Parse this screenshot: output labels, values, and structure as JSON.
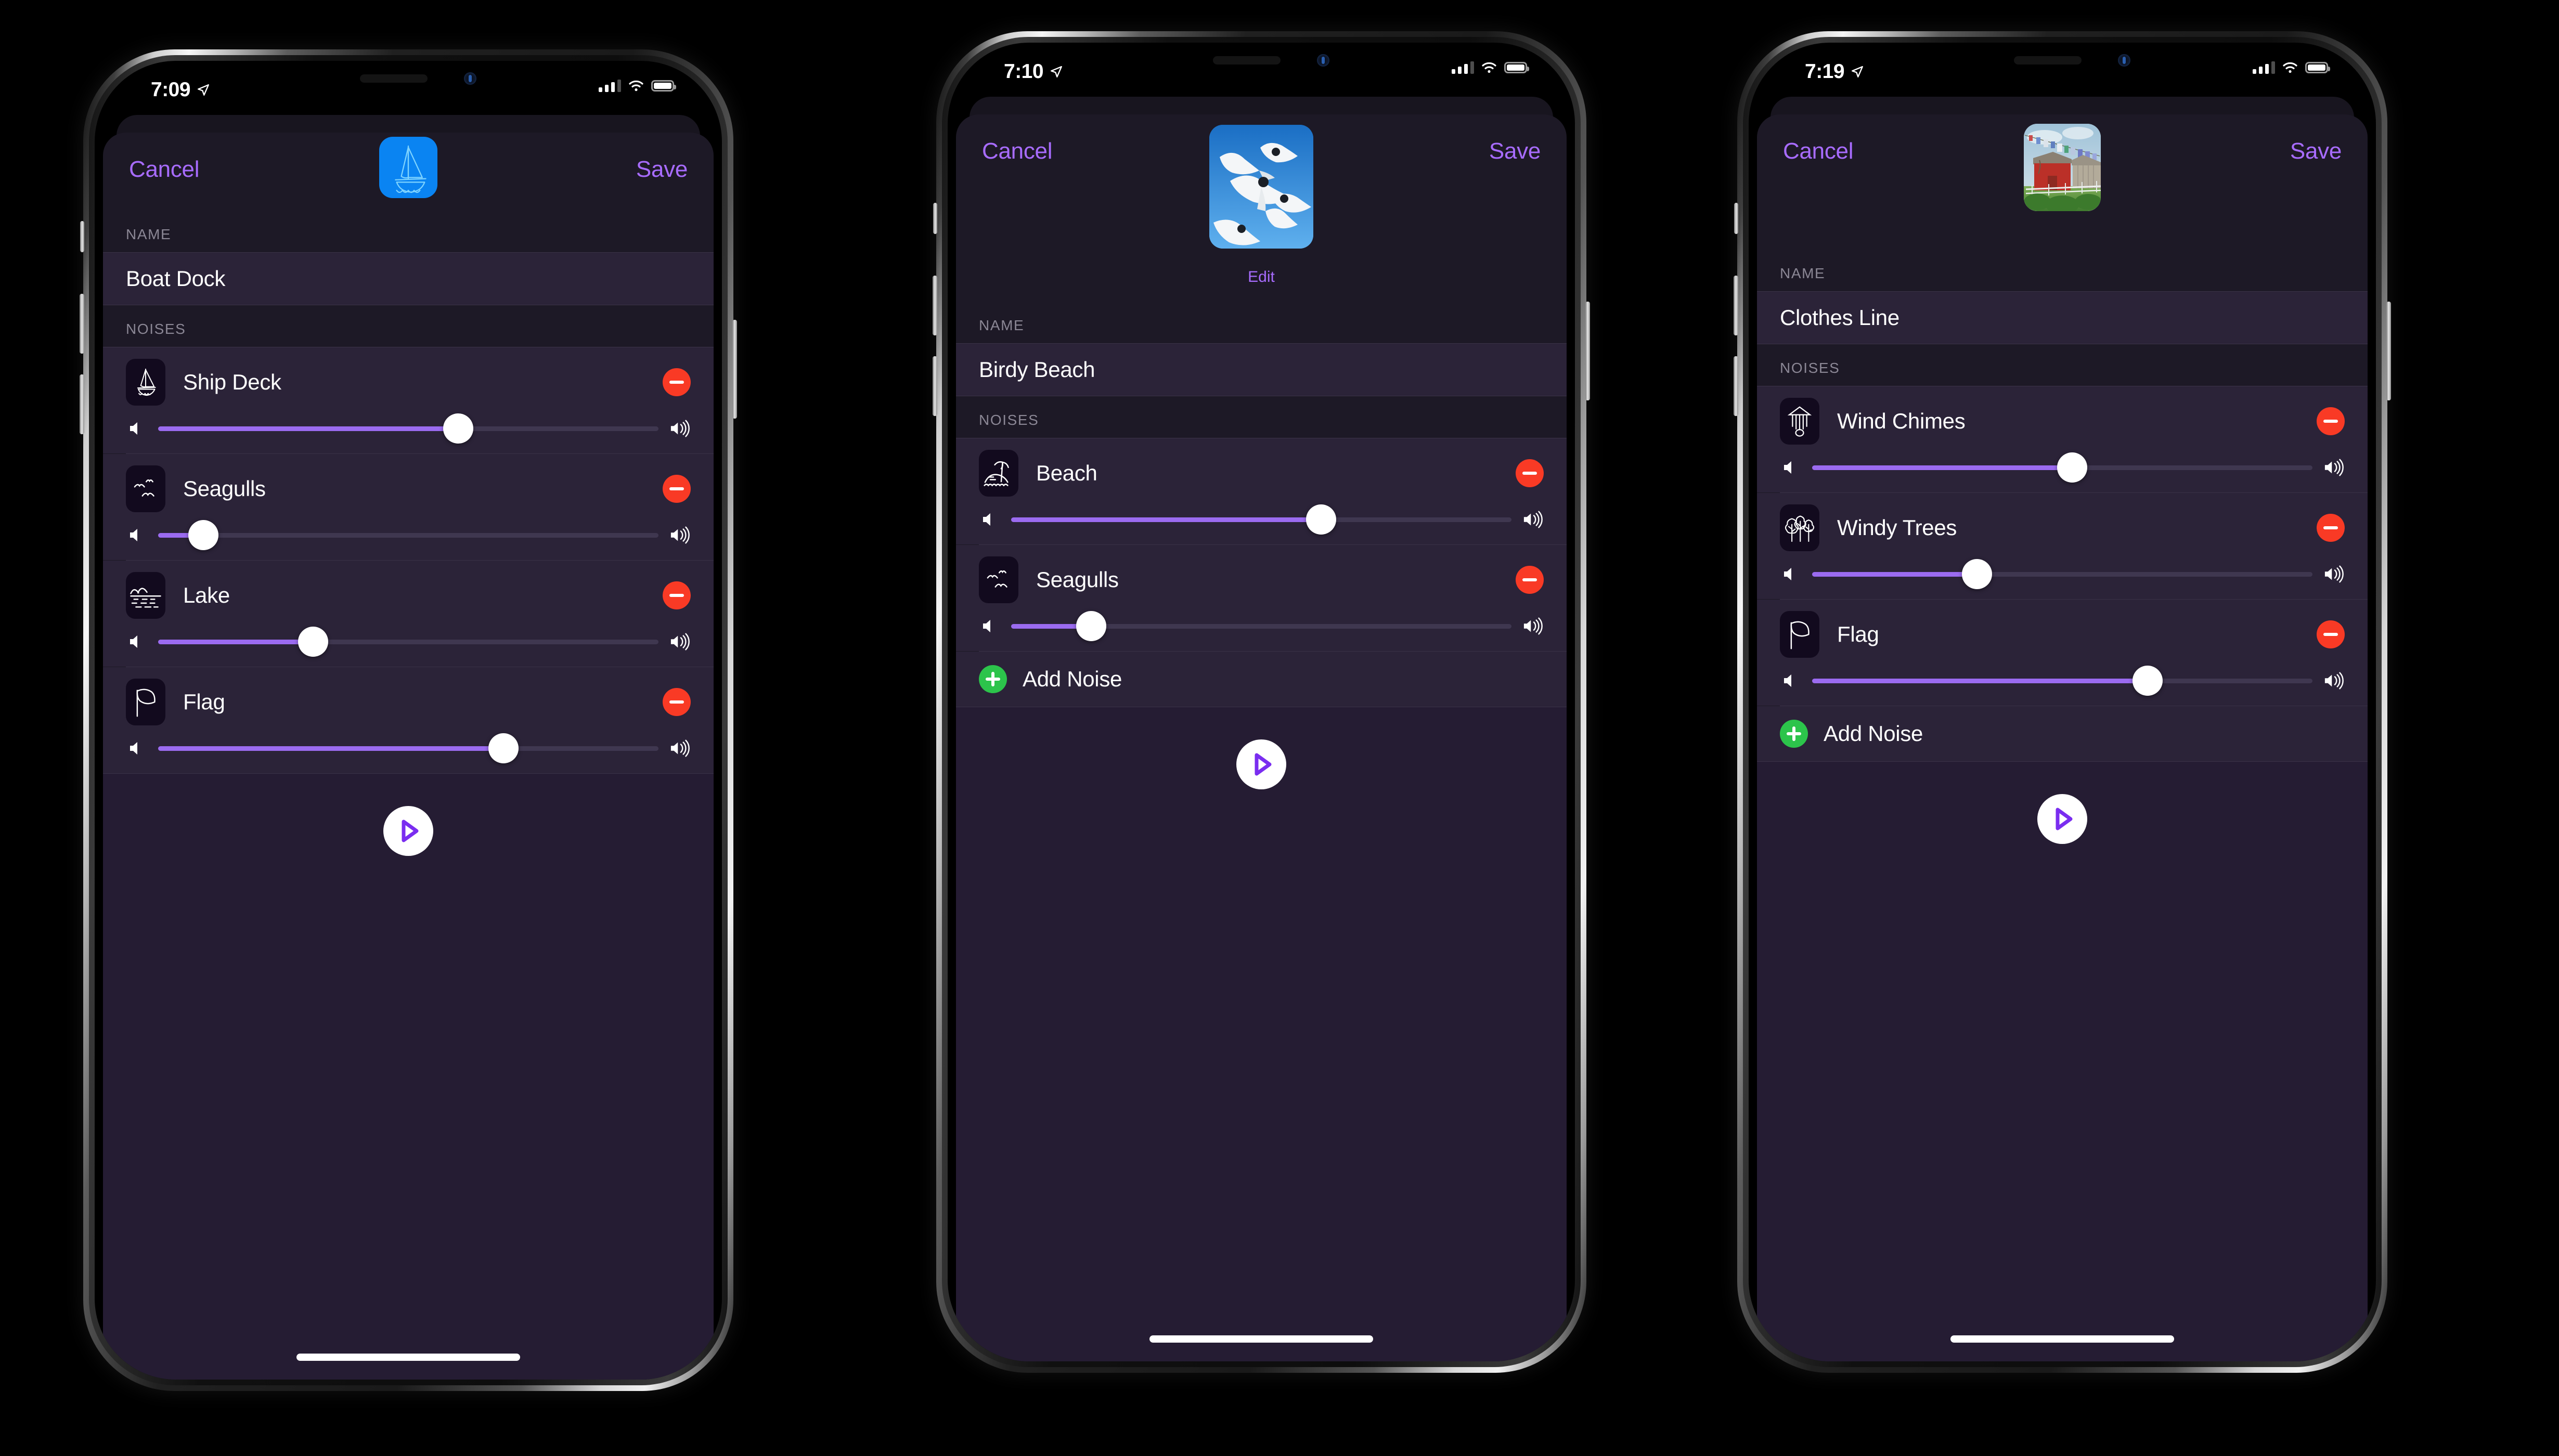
{
  "app": {
    "accent_purple": "#a86cff",
    "slider_fill": "#9b6bf0",
    "remove_red": "#f93a25",
    "add_green": "#2cc44b",
    "row_bg": "#2b2338",
    "sheet_bg": "#1d1926",
    "footer_bg": "#251c33"
  },
  "phones": [
    {
      "status": {
        "time": "7:09",
        "location_icon": "location-arrow-icon",
        "signal_icon": "cellular-bars-icon",
        "wifi_icon": "wifi-icon",
        "battery_icon": "battery-icon"
      },
      "nav": {
        "cancel_label": "Cancel",
        "save_label": "Save"
      },
      "artwork": {
        "type": "icon-tile",
        "icon": "sailboat-icon",
        "tile_color": "#0a84f2",
        "edit_label": null
      },
      "name_section": {
        "header": "NAME",
        "value": "Boat Dock"
      },
      "noises_section": {
        "header": "NOISES",
        "items": [
          {
            "icon": "sailboat-icon",
            "label": "Ship Deck",
            "volume": 60,
            "remove_label": "remove"
          },
          {
            "icon": "seagulls-icon",
            "label": "Seagulls",
            "volume": 9,
            "remove_label": "remove"
          },
          {
            "icon": "lake-icon",
            "label": "Lake",
            "volume": 31,
            "remove_label": "remove"
          },
          {
            "icon": "flag-icon",
            "label": "Flag",
            "volume": 69,
            "remove_label": "remove"
          }
        ],
        "add_label": null
      },
      "footer": {
        "play_icon": "play-icon"
      }
    },
    {
      "status": {
        "time": "7:10",
        "location_icon": "location-arrow-icon",
        "signal_icon": "cellular-bars-icon",
        "wifi_icon": "wifi-icon",
        "battery_icon": "battery-icon"
      },
      "nav": {
        "cancel_label": "Cancel",
        "save_label": "Save"
      },
      "artwork": {
        "type": "photo",
        "icon": "seagulls-photo",
        "tile_color": "#2f8ede",
        "edit_label": "Edit"
      },
      "name_section": {
        "header": "NAME",
        "value": "Birdy Beach"
      },
      "noises_section": {
        "header": "NOISES",
        "items": [
          {
            "icon": "beach-icon",
            "label": "Beach",
            "volume": 62,
            "remove_label": "remove"
          },
          {
            "icon": "seagulls-icon",
            "label": "Seagulls",
            "volume": 16,
            "remove_label": "remove"
          }
        ],
        "add_label": "Add Noise"
      },
      "footer": {
        "play_icon": "play-icon"
      }
    },
    {
      "status": {
        "time": "7:19",
        "location_icon": "location-arrow-icon",
        "signal_icon": "cellular-bars-icon",
        "wifi_icon": "wifi-icon",
        "battery_icon": "battery-icon"
      },
      "nav": {
        "cancel_label": "Cancel",
        "save_label": "Save"
      },
      "artwork": {
        "type": "photo",
        "icon": "barn-clothesline-photo",
        "tile_color": "#b9cfdc",
        "edit_label": null
      },
      "name_section": {
        "header": "NAME",
        "value": "Clothes Line"
      },
      "noises_section": {
        "header": "NOISES",
        "items": [
          {
            "icon": "wind-chimes-icon",
            "label": "Wind Chimes",
            "volume": 52,
            "remove_label": "remove"
          },
          {
            "icon": "windy-trees-icon",
            "label": "Windy Trees",
            "volume": 33,
            "remove_label": "remove"
          },
          {
            "icon": "flag-icon",
            "label": "Flag",
            "volume": 67,
            "remove_label": "remove"
          }
        ],
        "add_label": "Add Noise"
      },
      "footer": {
        "play_icon": "play-icon"
      }
    }
  ]
}
